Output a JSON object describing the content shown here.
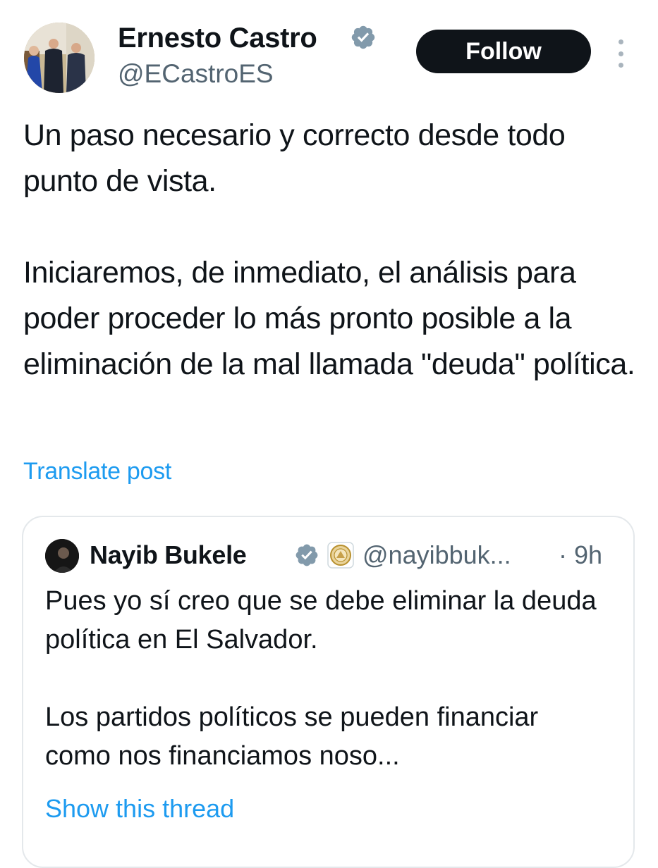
{
  "post": {
    "author_name": "Ernesto Castro",
    "author_handle": "@ECastroES",
    "verified_icon": "verified-badge-icon",
    "follow_label": "Follow",
    "more_icon": "more-vertical-icon",
    "text_paragraphs": [
      "Un paso necesario y correcto desde todo punto de vista.",
      "Iniciaremos, de inmediato, el análisis para poder proceder lo más pronto posible a la eliminación de la mal llamada \"deuda\" política."
    ],
    "translate_label": "Translate post"
  },
  "quoted": {
    "author_name": "Nayib Bukele",
    "author_handle": "@nayibbuk...",
    "time": "· 9h",
    "text_paragraphs": [
      "Pues yo sí creo que se debe eliminar la deuda política en El Salvador.",
      "Los partidos políticos se pueden financiar como nos financiamos noso..."
    ],
    "show_thread_label": "Show this thread"
  },
  "colors": {
    "text": "#0f1419",
    "secondary": "#536471",
    "link": "#1d9bf0",
    "verified_badge": "#829aab",
    "button_bg": "#0f1419",
    "card_border": "#e4e8eb"
  }
}
